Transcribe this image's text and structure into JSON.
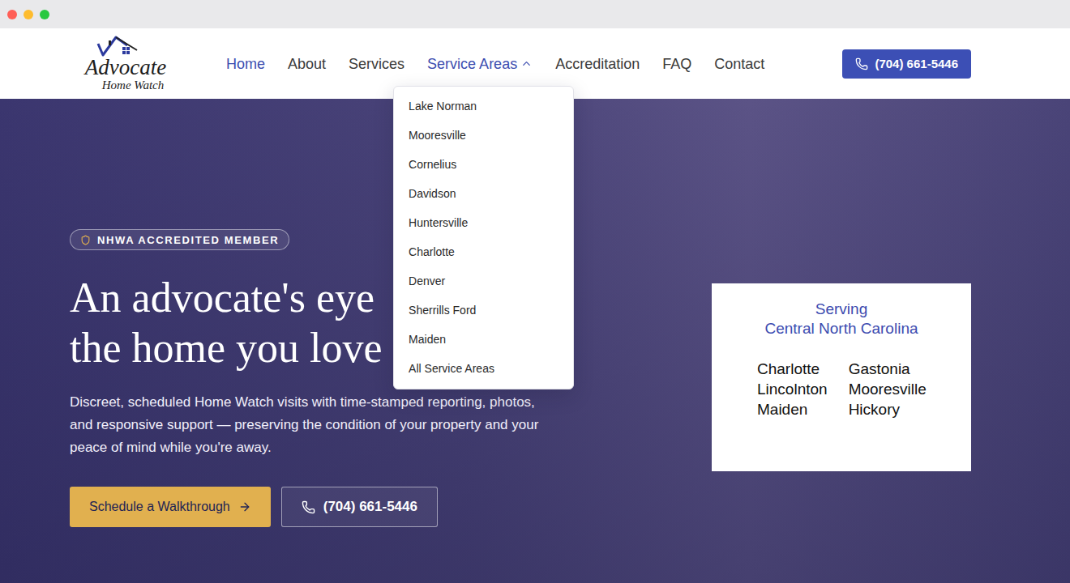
{
  "window_controls": [
    {
      "color": "#ff5f57"
    },
    {
      "color": "#febc2e"
    },
    {
      "color": "#28c840"
    }
  ],
  "logo": {
    "title": "Advocate",
    "subtitle": "Home Watch"
  },
  "nav": [
    {
      "label": "Home",
      "selected": true,
      "expanded": false,
      "has_menu": false
    },
    {
      "label": "About",
      "selected": false,
      "expanded": false,
      "has_menu": false
    },
    {
      "label": "Services",
      "selected": false,
      "expanded": false,
      "has_menu": false
    },
    {
      "label": "Service Areas",
      "selected": true,
      "expanded": true,
      "has_menu": true
    },
    {
      "label": "Accreditation",
      "selected": false,
      "expanded": false,
      "has_menu": false
    },
    {
      "label": "FAQ",
      "selected": false,
      "expanded": false,
      "has_menu": false
    },
    {
      "label": "Contact",
      "selected": false,
      "expanded": false,
      "has_menu": false
    }
  ],
  "phone_button": "(704) 661-5446",
  "dropdown": [
    "Lake Norman",
    "Mooresville",
    "Cornelius",
    "Davidson",
    "Huntersville",
    "Charlotte",
    "Denver",
    "Sherrills Ford",
    "Maiden",
    "All Service Areas"
  ],
  "hero": {
    "badge": "NHWA ACCREDITED MEMBER",
    "headline": [
      "An advocate's eye",
      "the home you love"
    ],
    "description": [
      "Discreet, scheduled Home Watch visits with time-stamped reporting, photos,",
      "and responsive support — preserving the condition of your property and your",
      "peace of mind while you're away."
    ],
    "primary_button": "Schedule a Walkthrough",
    "secondary_button": "(704) 661-5446"
  },
  "service_card": {
    "title": [
      "Serving",
      "Central North Carolina"
    ],
    "cities": [
      "Charlotte",
      "Lincolnton",
      "Maiden",
      "Gastonia",
      "Mooresville",
      "Hickory"
    ]
  }
}
